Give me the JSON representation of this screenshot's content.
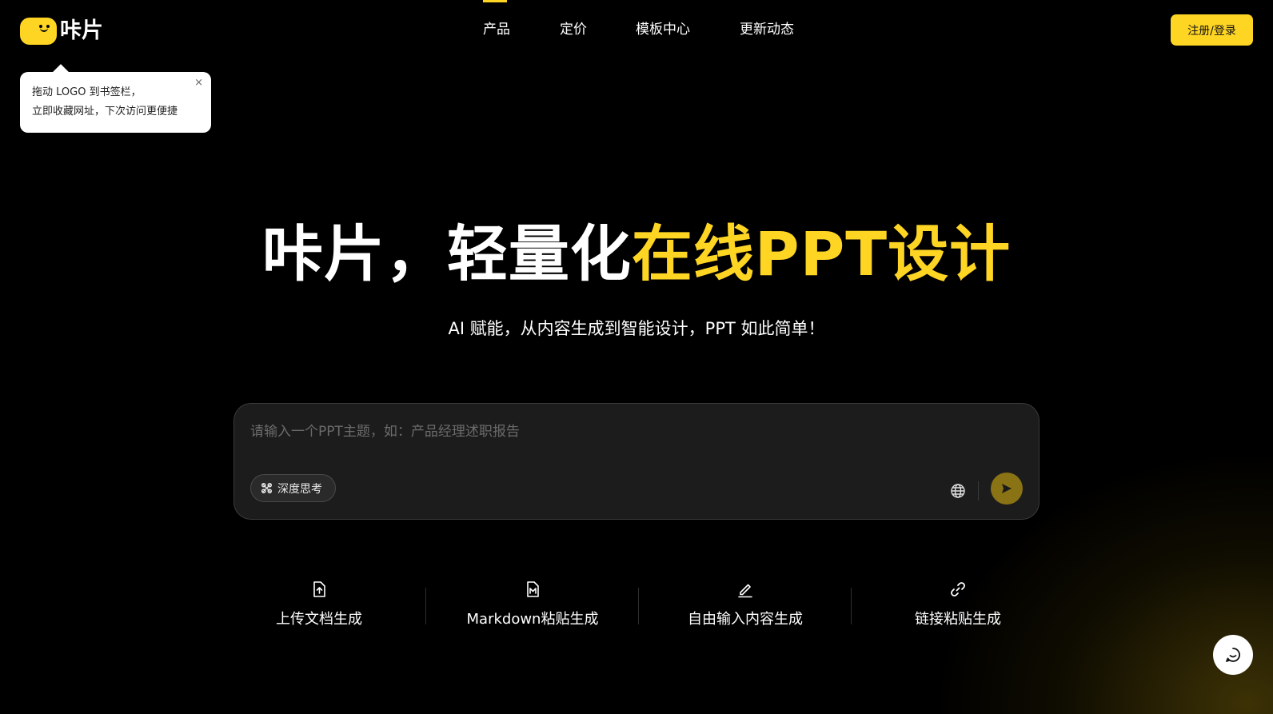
{
  "header": {
    "logo_text": "咔片",
    "nav": [
      {
        "label": "产品",
        "active": true
      },
      {
        "label": "定价"
      },
      {
        "label": "模板中心"
      },
      {
        "label": "更新动态"
      }
    ],
    "login_label": "注册/登录"
  },
  "tooltip": {
    "line1": "拖动 LOGO 到书签栏，",
    "line2": "立即收藏网址，下次访问更便捷",
    "close": "×"
  },
  "hero": {
    "title_white": "咔片，轻量化",
    "title_yellow": "在线PPT设计",
    "subtitle": "AI 赋能，从内容生成到智能设计，PPT 如此简单！"
  },
  "input": {
    "placeholder": "请输入一个PPT主题，如：产品经理述职报告",
    "value": "",
    "deep_think_label": "深度思考"
  },
  "options": [
    {
      "label": "上传文档生成",
      "icon": "upload-file-icon"
    },
    {
      "label": "Markdown粘贴生成",
      "icon": "markdown-file-icon"
    },
    {
      "label": "自由输入内容生成",
      "icon": "pen-icon"
    },
    {
      "label": "链接粘贴生成",
      "icon": "link-icon"
    }
  ],
  "colors": {
    "accent": "#ffd524",
    "background": "#000000",
    "send_button": "#8a7314"
  }
}
